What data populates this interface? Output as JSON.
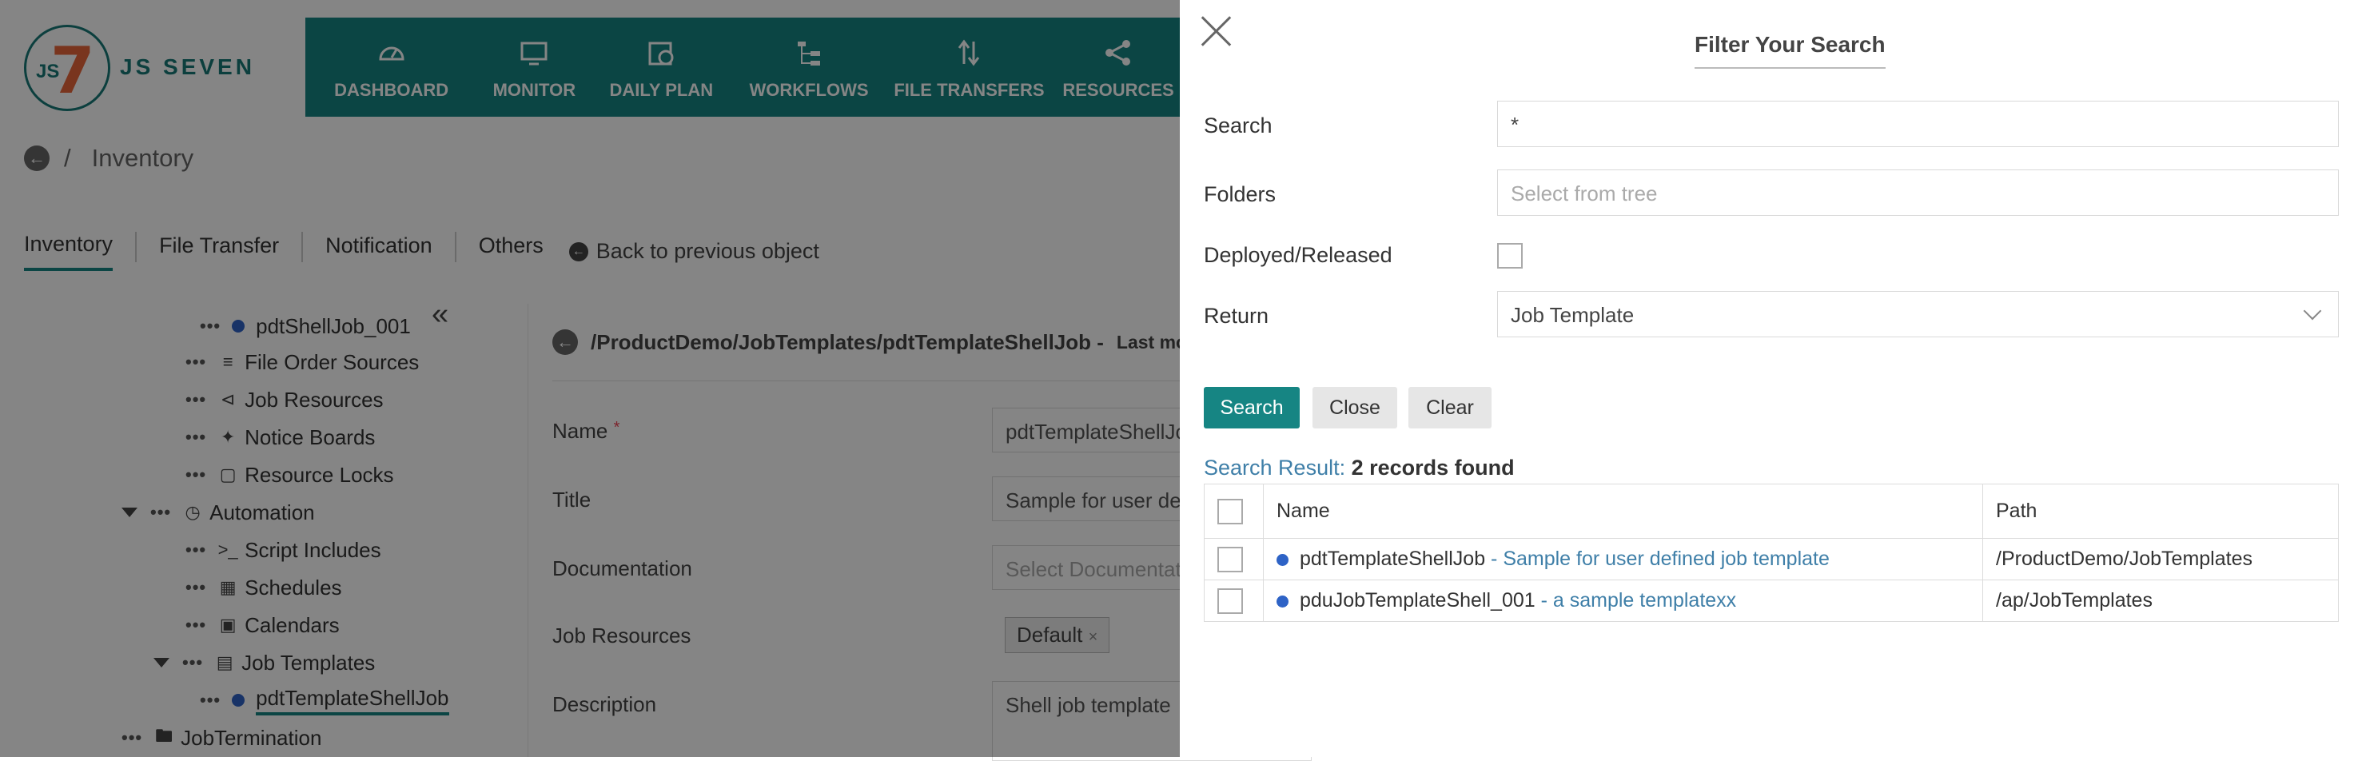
{
  "app": {
    "logo_text": "JS SEVEN",
    "logo_mark": "JS7"
  },
  "nav": [
    {
      "label": "DASHBOARD",
      "icon": "dashboard-icon"
    },
    {
      "label": "MONITOR",
      "icon": "monitor-icon"
    },
    {
      "label": "DAILY PLAN",
      "icon": "calendar-clock-icon"
    },
    {
      "label": "WORKFLOWS",
      "icon": "workflow-icon"
    },
    {
      "label": "FILE TRANSFERS",
      "icon": "transfer-arrows-icon"
    },
    {
      "label": "RESOURCES",
      "icon": "share-icon"
    }
  ],
  "breadcrumb": {
    "separator": "/",
    "current": "Inventory"
  },
  "subtabs": [
    "Inventory",
    "File Transfer",
    "Notification",
    "Others"
  ],
  "back_to_previous": "Back to previous object",
  "tree": {
    "items": [
      {
        "label": "pdtShellJob_001",
        "icon": "dot"
      },
      {
        "label": "File Order Sources",
        "icon": "list-icon"
      },
      {
        "label": "Job Resources",
        "icon": "share-icon"
      },
      {
        "label": "Notice Boards",
        "icon": "pin-icon"
      },
      {
        "label": "Resource Locks",
        "icon": "lock-icon"
      },
      {
        "label": "Automation",
        "icon": "clock-icon"
      },
      {
        "label": "Script Includes",
        "icon": "terminal-icon"
      },
      {
        "label": "Schedules",
        "icon": "schedule-icon"
      },
      {
        "label": "Calendars",
        "icon": "calendar-icon"
      },
      {
        "label": "Job Templates",
        "icon": "document-icon"
      },
      {
        "label": "pdtTemplateShellJob",
        "icon": "dot"
      },
      {
        "label": "JobTermination",
        "icon": "folder-icon"
      }
    ]
  },
  "editor": {
    "path": "/ProductDemo/JobTemplates/pdtTemplateShellJob -",
    "last_modified_label": "Last modi",
    "fields": {
      "name_label": "Name",
      "name_required": "*",
      "name_value": "pdtTemplateShellJo",
      "title_label": "Title",
      "title_value": "Sample for user de",
      "documentation_label": "Documentation",
      "documentation_placeholder": "Select Documentati",
      "job_resources_label": "Job Resources",
      "job_resources_chip": "Default",
      "chip_remove": "×",
      "description_label": "Description",
      "description_value": "Shell job template"
    }
  },
  "filter_panel": {
    "title": "Filter Your Search",
    "search_label": "Search",
    "search_value": "*",
    "folders_label": "Folders",
    "folders_placeholder": "Select from tree",
    "deployed_label": "Deployed/Released",
    "deployed_checked": false,
    "return_label": "Return",
    "return_value": "Job Template",
    "buttons": {
      "search": "Search",
      "close": "Close",
      "clear": "Clear"
    },
    "result_label": "Search Result",
    "result_count": "2 records found",
    "table": {
      "headers": [
        "Name",
        "Path"
      ],
      "rows": [
        {
          "name": "pdtTemplateShellJob",
          "desc": "- Sample for user defined job template",
          "path": "/ProductDemo/JobTemplates"
        },
        {
          "name": "pduJobTemplateShell_001",
          "desc": "- a sample templatexx",
          "path": "/ap/JobTemplates"
        }
      ]
    }
  },
  "colors": {
    "brand": "#168583",
    "link": "#3f7fa8",
    "dot": "#2e63c6"
  }
}
